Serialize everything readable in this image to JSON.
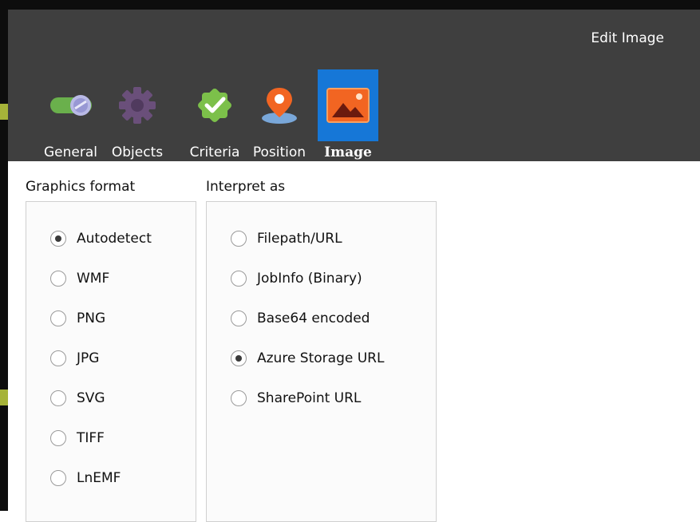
{
  "window": {
    "title": "Edit Image"
  },
  "toolbar": {
    "items": [
      {
        "label": "General",
        "icon": "toggle-switch-icon",
        "selected": false
      },
      {
        "label": "Objects",
        "icon": "gear-icon",
        "selected": false
      },
      {
        "label": "Criteria",
        "icon": "badge-check-icon",
        "selected": false
      },
      {
        "label": "Position",
        "icon": "map-pin-icon",
        "selected": false
      },
      {
        "label": "Image",
        "icon": "image-icon",
        "selected": true
      }
    ]
  },
  "graphics_format": {
    "title": "Graphics format",
    "options": [
      "Autodetect",
      "WMF",
      "PNG",
      "JPG",
      "SVG",
      "TIFF",
      "LnEMF"
    ],
    "selected": "Autodetect"
  },
  "interpret_as": {
    "title": "Interpret as",
    "options": [
      "Filepath/URL",
      "JobInfo (Binary)",
      "Base64 encoded",
      "Azure Storage URL",
      "SharePoint URL"
    ],
    "selected": "Azure Storage URL"
  },
  "colors": {
    "header_bg": "#3f3f3f",
    "selected_tool_bg": "#1677d7",
    "general_icon": "#6ab04c",
    "objects_icon": "#6a4f7a",
    "criteria_icon": "#7cc04a",
    "position_icon": "#f26522",
    "image_icon": "#f26522"
  }
}
